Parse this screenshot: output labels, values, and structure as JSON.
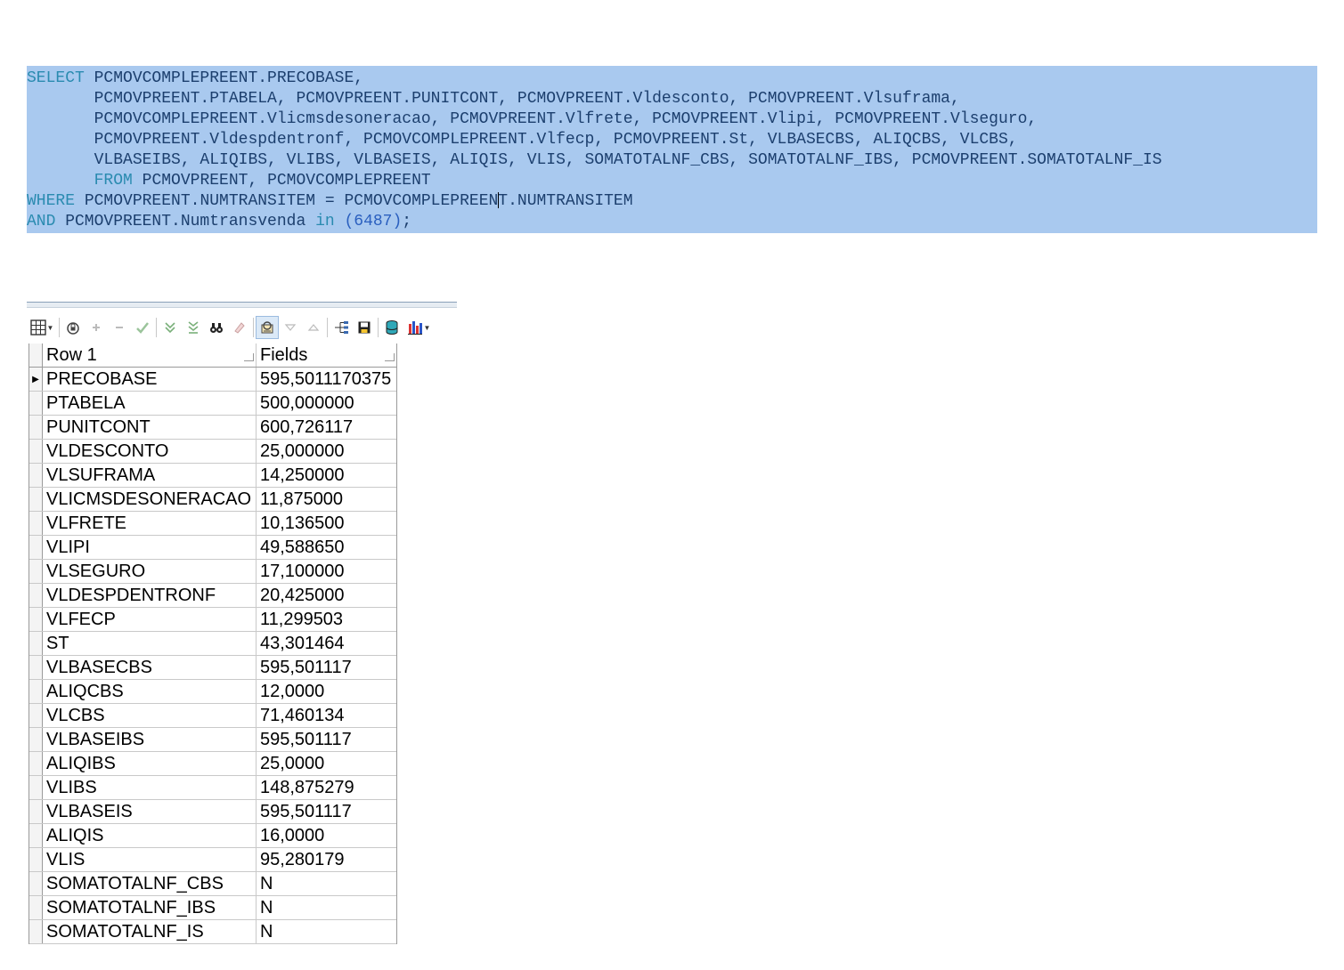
{
  "sql": {
    "lines": [
      {
        "kw": "SELECT",
        "text": " PCMOVCOMPLEPREENT.PRECOBASE,"
      },
      {
        "kw": "",
        "text": "       PCMOVPREENT.PTABELA, PCMOVPREENT.PUNITCONT, PCMOVPREENT.Vldesconto, PCMOVPREENT.Vlsuframa,"
      },
      {
        "kw": "",
        "text": "       PCMOVCOMPLEPREENT.Vlicmsdesoneracao, PCMOVPREENT.Vlfrete, PCMOVPREENT.Vlipi, PCMOVPREENT.Vlseguro,"
      },
      {
        "kw": "",
        "text": "       PCMOVPREENT.Vldespdentronf, PCMOVCOMPLEPREENT.Vlfecp, PCMOVPREENT.St, VLBASECBS, ALIQCBS, VLCBS,"
      },
      {
        "kw": "",
        "text": "       VLBASEIBS, ALIQIBS, VLIBS, VLBASEIS, ALIQIS, VLIS, SOMATOTALNF_CBS, SOMATOTALNF_IBS, PCMOVPREENT.SOMATOTALNF_IS"
      },
      {
        "pre": "       ",
        "kw": "FROM",
        "text": " PCMOVPREENT, PCMOVCOMPLEPREENT"
      },
      {
        "kw": "WHERE",
        "text": " PCMOVPREENT.NUMTRANSITEM = PCMOVCOMPLEPREEN",
        "text2": "T.NUMTRANSITEM"
      },
      {
        "kw": "AND",
        "text": " PCMOVPREENT.Numtransvenda ",
        "kw2": "in",
        "num": " (6487)",
        "tail": ";"
      }
    ]
  },
  "toolbar": {
    "icons": [
      "grid-view-icon",
      "lock-icon",
      "plus-icon",
      "minus-icon",
      "check-icon",
      "move-down-icon",
      "move-last-icon",
      "find-icon",
      "eraser-icon",
      "lookup-icon",
      "filter-down-icon",
      "filter-up-icon",
      "tree-icon",
      "save-icon",
      "database-icon",
      "chart-icon"
    ]
  },
  "grid": {
    "header": {
      "col1": "Row 1",
      "col2": "Fields"
    },
    "rows": [
      {
        "field": "PRECOBASE",
        "value": "595,5011170375"
      },
      {
        "field": "PTABELA",
        "value": "500,000000"
      },
      {
        "field": "PUNITCONT",
        "value": "600,726117"
      },
      {
        "field": "VLDESCONTO",
        "value": "25,000000"
      },
      {
        "field": "VLSUFRAMA",
        "value": "14,250000"
      },
      {
        "field": "VLICMSDESONERACAO",
        "value": "11,875000"
      },
      {
        "field": "VLFRETE",
        "value": "10,136500"
      },
      {
        "field": "VLIPI",
        "value": "49,588650"
      },
      {
        "field": "VLSEGURO",
        "value": "17,100000"
      },
      {
        "field": "VLDESPDENTRONF",
        "value": "20,425000"
      },
      {
        "field": "VLFECP",
        "value": "11,299503"
      },
      {
        "field": "ST",
        "value": "43,301464"
      },
      {
        "field": "VLBASECBS",
        "value": "595,501117"
      },
      {
        "field": "ALIQCBS",
        "value": "12,0000"
      },
      {
        "field": "VLCBS",
        "value": "71,460134"
      },
      {
        "field": "VLBASEIBS",
        "value": "595,501117"
      },
      {
        "field": "ALIQIBS",
        "value": "25,0000"
      },
      {
        "field": "VLIBS",
        "value": "148,875279"
      },
      {
        "field": "VLBASEIS",
        "value": "595,501117"
      },
      {
        "field": "ALIQIS",
        "value": "16,0000"
      },
      {
        "field": "VLIS",
        "value": "95,280179"
      },
      {
        "field": "SOMATOTALNF_CBS",
        "value": "N"
      },
      {
        "field": "SOMATOTALNF_IBS",
        "value": "N"
      },
      {
        "field": "SOMATOTALNF_IS",
        "value": "N"
      }
    ]
  }
}
